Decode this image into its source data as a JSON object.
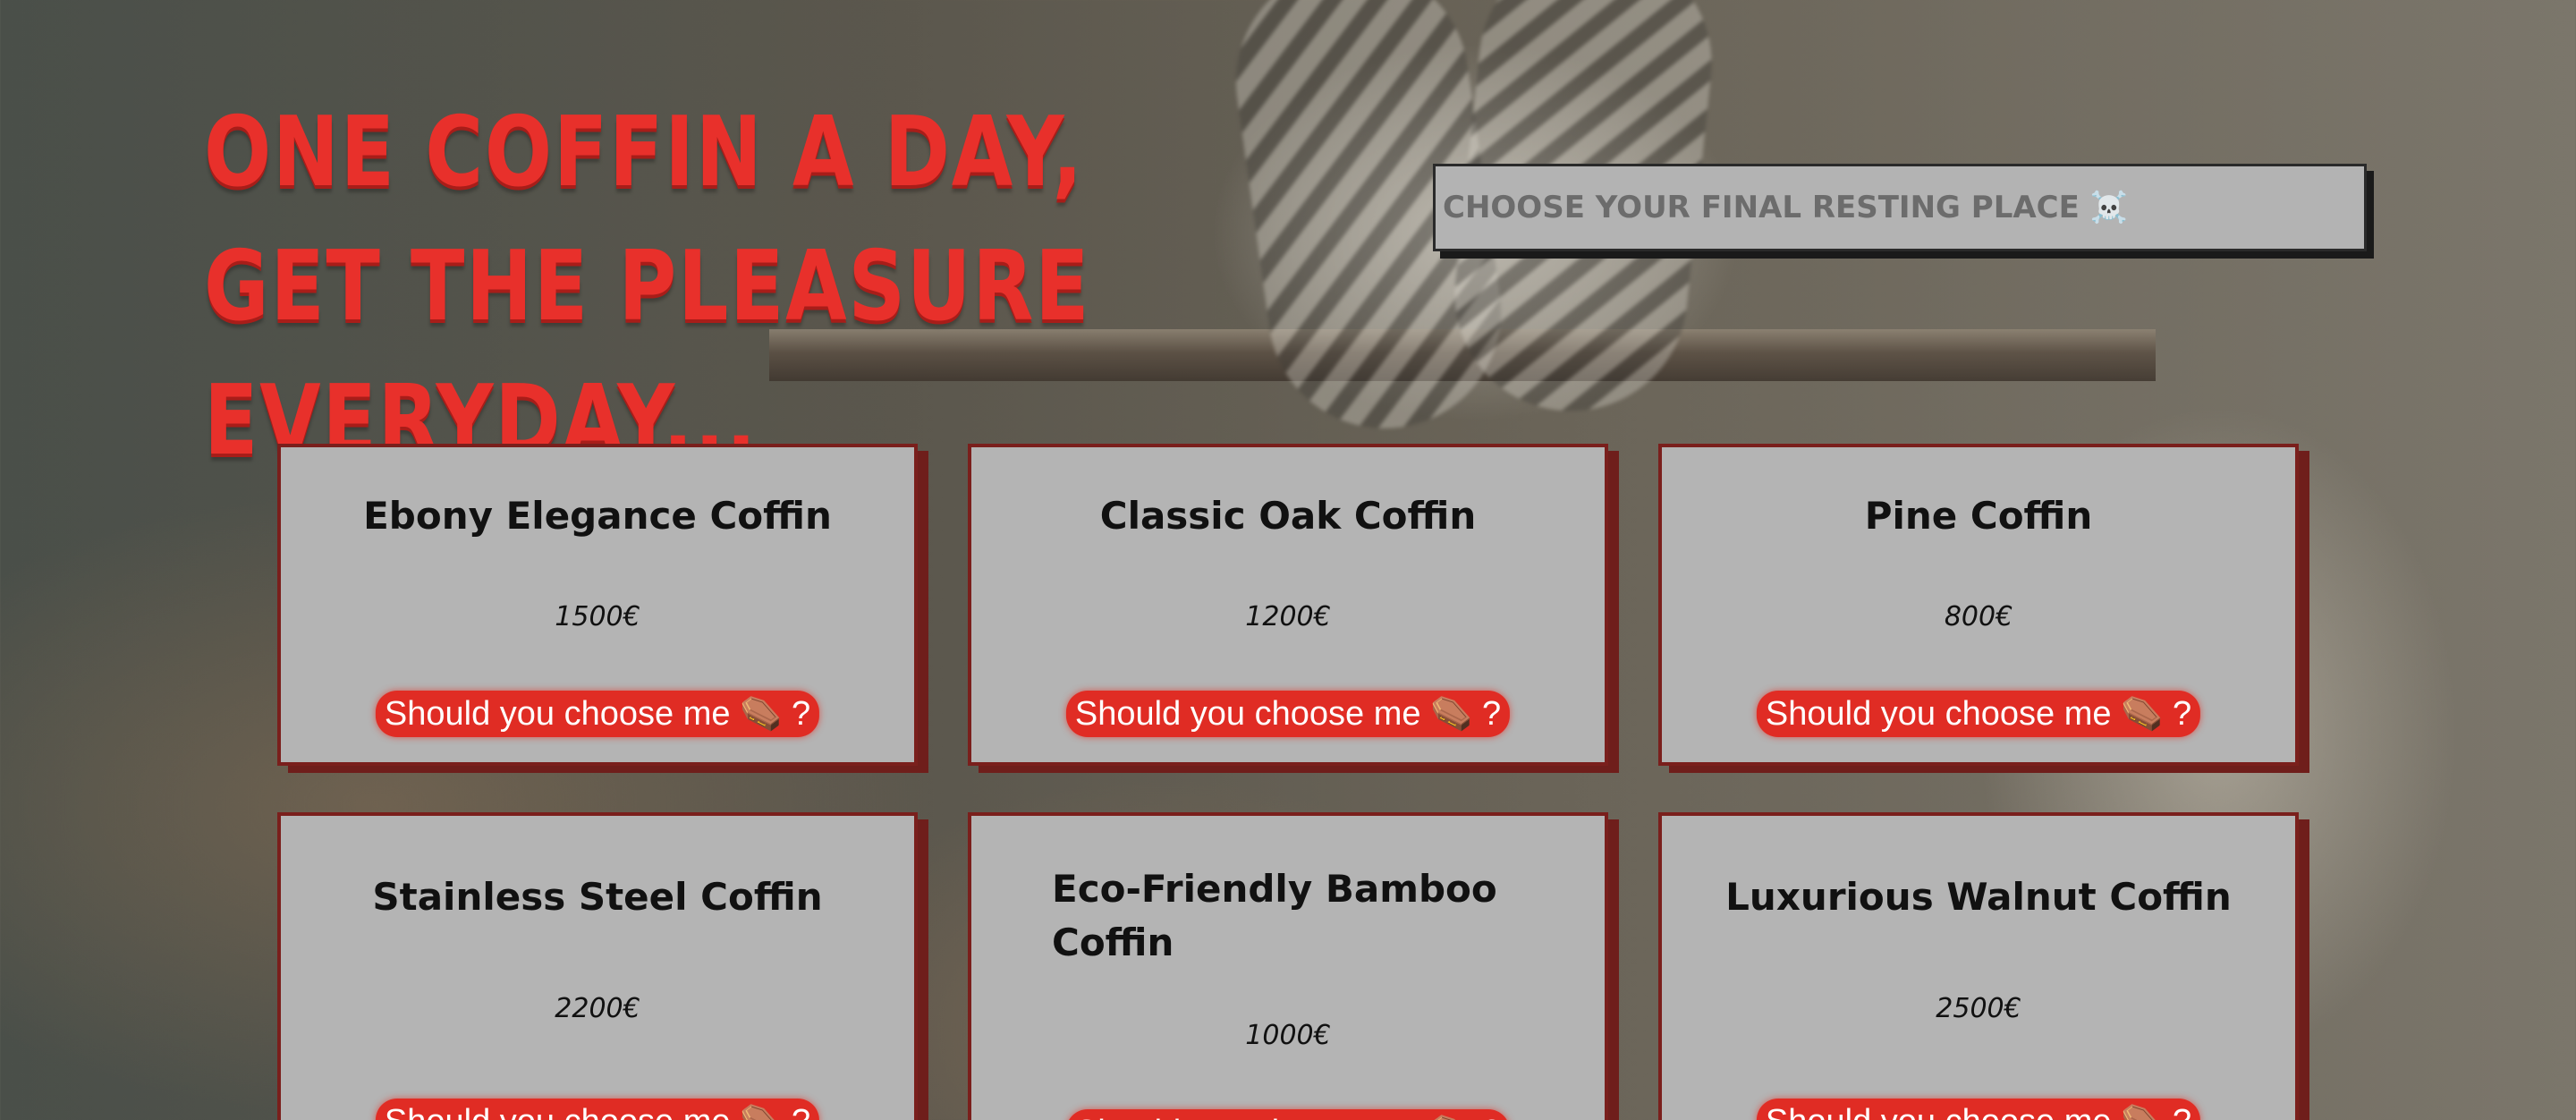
{
  "header": {
    "title": "One coffin a day, get the pleasure everyday..."
  },
  "search": {
    "placeholder": "Choose your final resting place ☠️"
  },
  "products": [
    {
      "name": "Ebony Elegance Coffin",
      "price": "1500€",
      "button_label": "Should you choose me ⚰️ ?"
    },
    {
      "name": "Classic Oak Coffin",
      "price": "1200€",
      "button_label": "Should you choose me ⚰️ ?"
    },
    {
      "name": "Pine Coffin",
      "price": "800€",
      "button_label": "Should you choose me ⚰️ ?"
    },
    {
      "name": "Stainless Steel Coffin",
      "price": "2200€",
      "button_label": "Should you choose me ⚰️ ?"
    },
    {
      "name": "Eco-Friendly Bamboo Coffin",
      "price": "1000€",
      "button_label": "Should you choose me ⚰️ ?"
    },
    {
      "name": "Luxurious Walnut Coffin",
      "price": "2500€",
      "button_label": "Should you choose me ⚰️ ?"
    }
  ],
  "colors": {
    "accent": "#e8302b",
    "card_background": "#b4b4b4",
    "card_border": "#7a1f1c",
    "button": "#e02c24"
  }
}
